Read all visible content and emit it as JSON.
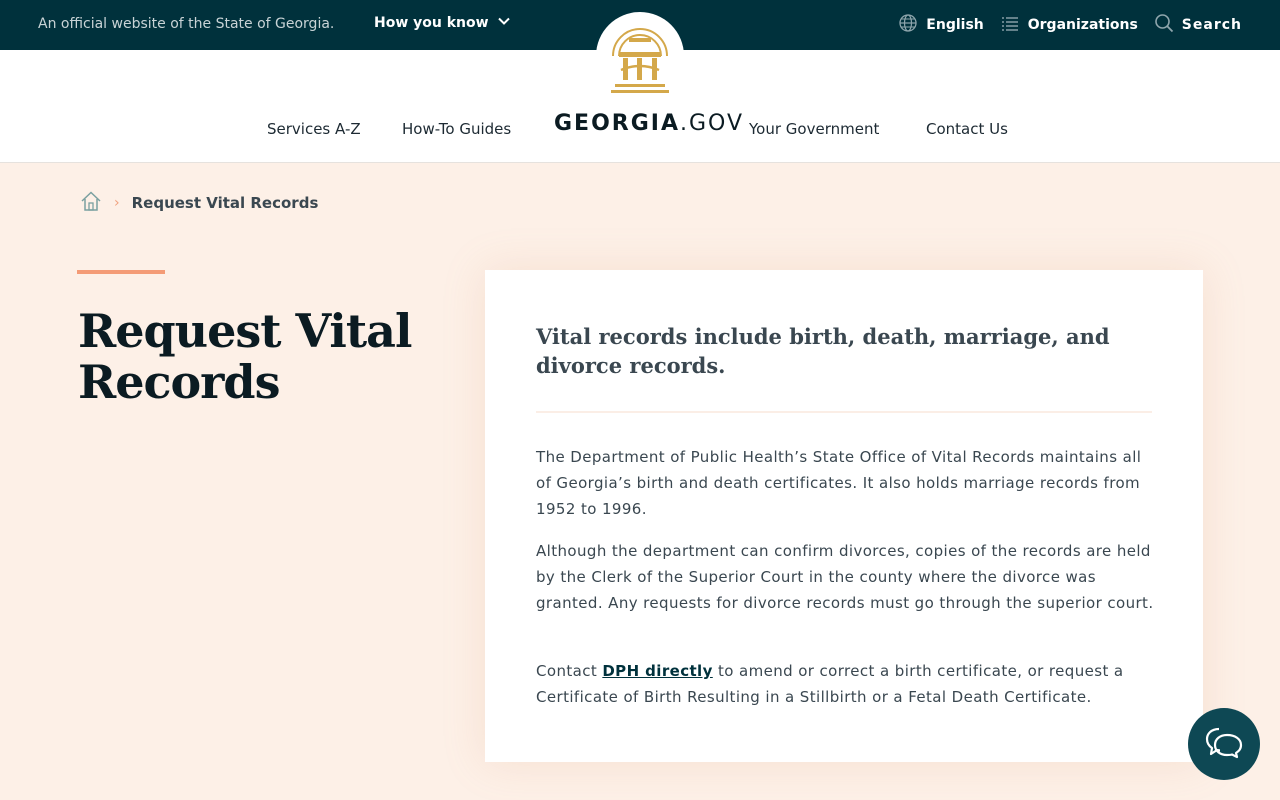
{
  "topbar": {
    "official_text": "An official website of the State of Georgia.",
    "how_you_know": "How you know",
    "language": "English",
    "organizations": "Organizations",
    "search": "Search"
  },
  "header": {
    "brand_bold": "GEORGIA",
    "brand_rest": ".GOV",
    "nav": {
      "services": "Services A-Z",
      "guides": "How-To Guides",
      "government": "Your Government",
      "contact": "Contact Us"
    }
  },
  "breadcrumb": {
    "current": "Request Vital Records"
  },
  "page": {
    "title": "Request Vital Records"
  },
  "card": {
    "lead": "Vital records include birth, death, marriage, and divorce records.",
    "p1": "The Department of Public Health’s State Office of Vital Records maintains all of Georgia’s birth and death certificates. It also holds marriage records from 1952 to 1996.",
    "p2": "Although the department can confirm divorces, copies of the records are held by the Clerk of the Superior Court in the county where the divorce was granted. Any requests for divorce records must go through the superior court.",
    "p3_before": "Contact ",
    "p3_link": "DPH directly",
    "p3_after": " to amend or correct a birth certificate, or request a Certificate of Birth Resulting in a Stillbirth or a Fetal Death Certificate."
  },
  "colors": {
    "topbar_bg": "#00313c",
    "page_bg": "#fdf0e7",
    "accent": "#f49b76",
    "seal_gold": "#d4a84a",
    "chat_bg": "#0e4854"
  },
  "icons": [
    "chevron-down-icon",
    "globe-icon",
    "list-icon",
    "search-icon",
    "state-seal-logo",
    "home-icon",
    "chevron-right-icon",
    "chat-icon"
  ]
}
